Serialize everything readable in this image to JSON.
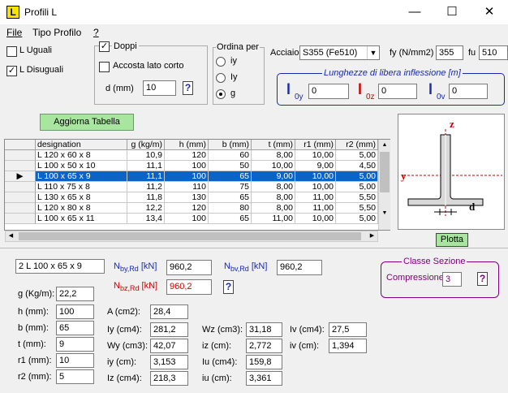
{
  "window": {
    "title": "Profili L",
    "minimize": "—",
    "maximize": "☐",
    "close": "✕"
  },
  "menu": {
    "file": "File",
    "tipo": "Tipo Profilo",
    "help": "?"
  },
  "profile_type": {
    "uguali": "L Uguali",
    "disuguali": "L Disuguali",
    "uguali_checked": false,
    "disuguali_checked": true
  },
  "options": {
    "doppi": "Doppi",
    "accosta": "Accosta lato corto",
    "d_label": "d (mm)",
    "d_value": "10",
    "help": "?"
  },
  "sort": {
    "title": "Ordina per",
    "iy": "iy",
    "Iy": "Iy",
    "g": "g",
    "selected": "g"
  },
  "material": {
    "acciaio_label": "Acciaio",
    "acciaio_value": "S355 (Fe510)",
    "fy_label": "fy (N/mm2)",
    "fy_value": "355",
    "fu_label": "fu",
    "fu_value": "510"
  },
  "lengths": {
    "title": "Lunghezze di libera inflessione [m]",
    "l0y_main": "l",
    "l0y_sub": "0y",
    "l0y_value": "0",
    "l0z_main": "l",
    "l0z_sub": "0z",
    "l0z_value": "0",
    "l0v_main": "l",
    "l0v_sub": "0v",
    "l0v_value": "0"
  },
  "update_button": "Aggiorna Tabella",
  "table": {
    "headers": [
      "designation",
      "g (kg/m)",
      "h (mm)",
      "b (mm)",
      "t (mm)",
      "r1 (mm)",
      "r2 (mm)"
    ],
    "rows": [
      [
        "L 120 x 60 x 8",
        "10,9",
        "120",
        "60",
        "8,00",
        "10,00",
        "5,00"
      ],
      [
        "L 100 x 50 x 10",
        "11,1",
        "100",
        "50",
        "10,00",
        "9,00",
        "4,50"
      ],
      [
        "L 100 x 65 x 9",
        "11,1",
        "100",
        "65",
        "9,00",
        "10,00",
        "5,00"
      ],
      [
        "L 110 x 75 x 8",
        "11,2",
        "110",
        "75",
        "8,00",
        "10,00",
        "5,00"
      ],
      [
        "L 130 x 65 x 8",
        "11,8",
        "130",
        "65",
        "8,00",
        "11,00",
        "5,50"
      ],
      [
        "L 120 x 80 x 8",
        "12,2",
        "120",
        "80",
        "8,00",
        "11,00",
        "5,50"
      ],
      [
        "L 100 x 65 x 11",
        "13,4",
        "100",
        "65",
        "11,00",
        "10,00",
        "5,00"
      ]
    ],
    "selected_row": 2
  },
  "diagram": {
    "z": "z",
    "y": "y",
    "d": "d"
  },
  "plot_button": "Plotta",
  "results": {
    "designation": "2 L 100 x 65 x 9",
    "nby_main": "N",
    "nby_sub": "by,Rd",
    "nby_unit": "[kN]",
    "nby_value": "960,2",
    "nbz_main": "N",
    "nbz_sub": "bz,Rd",
    "nbz_unit": "[kN]",
    "nbz_value": "960,2",
    "nbv_main": "N",
    "nbv_sub": "bv,Rd",
    "nbv_unit": "[kN]",
    "nbv_value": "960,2",
    "help": "?"
  },
  "classe": {
    "title": "Classe Sezione",
    "label": "Compressione",
    "value": "3",
    "help": "?"
  },
  "props_left": [
    {
      "label": "g (Kg/m):",
      "value": "22,2"
    },
    {
      "label": "h (mm):",
      "value": "100"
    },
    {
      "label": "b (mm):",
      "value": "65"
    },
    {
      "label": "t (mm):",
      "value": "9"
    },
    {
      "label": "r1 (mm):",
      "value": "10"
    },
    {
      "label": "r2 (mm):",
      "value": "5"
    }
  ],
  "props_mid": [
    {
      "label": "A (cm2):",
      "value": "28,4"
    },
    {
      "label": "Iy (cm4):",
      "value": "281,2"
    },
    {
      "label": "Wy (cm3):",
      "value": "42,07"
    },
    {
      "label": "iy (cm):",
      "value": "3,153"
    },
    {
      "label": "Iz (cm4):",
      "value": "218,3"
    }
  ],
  "props_right": [
    {
      "label": "Wz (cm3):",
      "value": "31,18"
    },
    {
      "label": "iz (cm):",
      "value": "2,772"
    },
    {
      "label": "Iu (cm4):",
      "value": "159,8"
    },
    {
      "label": "iu (cm):",
      "value": "3,361"
    }
  ],
  "props_far": [
    {
      "label": "Iv (cm4):",
      "value": "27,5"
    },
    {
      "label": "iv (cm):",
      "value": "1,394"
    }
  ]
}
